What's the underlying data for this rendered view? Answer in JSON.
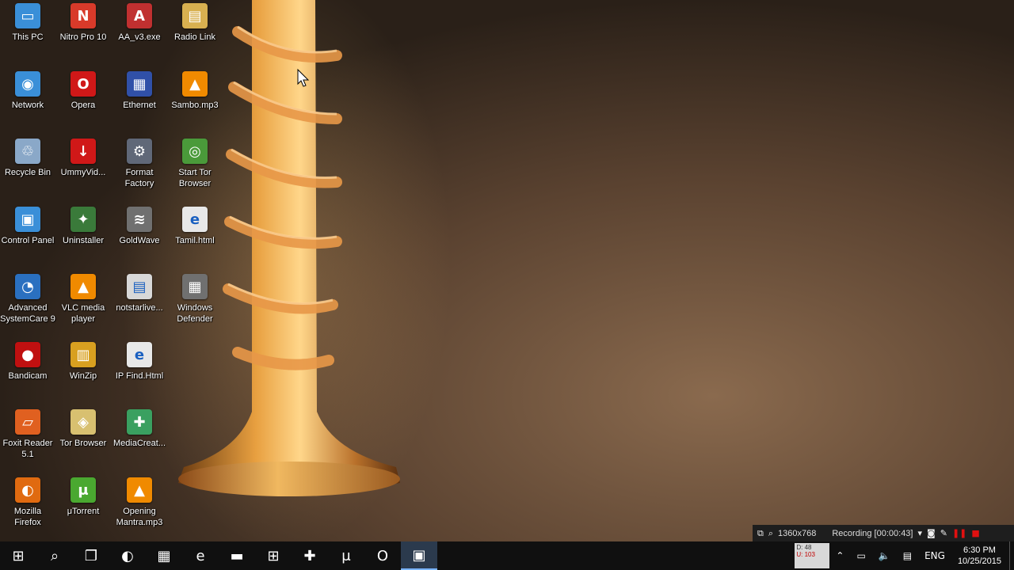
{
  "desktop": {
    "icons": [
      {
        "label": "This PC",
        "icon": "computer-icon",
        "color": "#3a8fd8",
        "glyph": "▭"
      },
      {
        "label": "Nitro Pro 10",
        "icon": "nitro-pdf-icon",
        "color": "#d83a2a",
        "glyph": "N"
      },
      {
        "label": "AA_v3.exe",
        "icon": "exe-icon",
        "color": "#c03030",
        "glyph": "A"
      },
      {
        "label": "Radio Link",
        "icon": "document-icon",
        "color": "#d8b050",
        "glyph": "▤"
      },
      {
        "label": "Network",
        "icon": "network-icon",
        "color": "#3a8fd8",
        "glyph": "◉"
      },
      {
        "label": "Opera",
        "icon": "opera-icon",
        "color": "#d01818",
        "glyph": "O"
      },
      {
        "label": "Ethernet",
        "icon": "ethernet-icon",
        "color": "#3050a8",
        "glyph": "▦"
      },
      {
        "label": "Sambo.mp3",
        "icon": "vlc-icon",
        "color": "#f08a00",
        "glyph": "▲"
      },
      {
        "label": "Recycle Bin",
        "icon": "recycle-bin-icon",
        "color": "#8aa8c8",
        "glyph": "♲"
      },
      {
        "label": "UmmyVid...",
        "icon": "ummy-icon",
        "color": "#d01818",
        "glyph": "↓"
      },
      {
        "label": "Format Factory",
        "icon": "format-factory-icon",
        "color": "#606878",
        "glyph": "⚙"
      },
      {
        "label": "Start Tor Browser",
        "icon": "tor-globe-icon",
        "color": "#4a9a3a",
        "glyph": "◎"
      },
      {
        "label": "Control Panel",
        "icon": "control-panel-icon",
        "color": "#3a8fd8",
        "glyph": "▣"
      },
      {
        "label": "Uninstaller",
        "icon": "uninstaller-icon",
        "color": "#3a7a3a",
        "glyph": "✦"
      },
      {
        "label": "GoldWave",
        "icon": "goldwave-icon",
        "color": "#707070",
        "glyph": "≋"
      },
      {
        "label": "Tamil.html",
        "icon": "html-file-icon",
        "color": "#e8e8e8",
        "glyph": "e"
      },
      {
        "label": "Advanced SystemCare 9",
        "icon": "systemcare-icon",
        "color": "#2a70c0",
        "glyph": "◔"
      },
      {
        "label": "VLC media player",
        "icon": "vlc-icon",
        "color": "#f08a00",
        "glyph": "▲"
      },
      {
        "label": "notstarlive...",
        "icon": "file-icon",
        "color": "#d8d8d8",
        "glyph": "▤"
      },
      {
        "label": "Windows Defender",
        "icon": "defender-icon",
        "color": "#707070",
        "glyph": "▦"
      },
      {
        "label": "Bandicam",
        "icon": "bandicam-icon",
        "color": "#c01010",
        "glyph": "●"
      },
      {
        "label": "WinZip",
        "icon": "winzip-icon",
        "color": "#d8a020",
        "glyph": "▥"
      },
      {
        "label": "IP Find.Html",
        "icon": "html-file-icon",
        "color": "#e8e8e8",
        "glyph": "e"
      },
      {
        "label": "",
        "icon": "",
        "color": "",
        "glyph": ""
      },
      {
        "label": "Foxit Reader 5.1",
        "icon": "foxit-icon",
        "color": "#e06020",
        "glyph": "▱"
      },
      {
        "label": "Tor Browser",
        "icon": "tor-folder-icon",
        "color": "#d8c070",
        "glyph": "◈"
      },
      {
        "label": "MediaCreat...",
        "icon": "media-creation-icon",
        "color": "#3aa060",
        "glyph": "✚"
      },
      {
        "label": "",
        "icon": "",
        "color": "",
        "glyph": ""
      },
      {
        "label": "Mozilla Firefox",
        "icon": "firefox-icon",
        "color": "#e06a10",
        "glyph": "◐"
      },
      {
        "label": "μTorrent",
        "icon": "utorrent-icon",
        "color": "#4aa830",
        "glyph": "μ"
      },
      {
        "label": "Opening Mantra.mp3",
        "icon": "vlc-icon",
        "color": "#f08a00",
        "glyph": "▲"
      }
    ]
  },
  "recording_bar": {
    "resolution": "1360x768",
    "status": "Recording [00:00:43]"
  },
  "taskbar": {
    "items": [
      {
        "name": "start-button",
        "glyph": "⊞"
      },
      {
        "name": "search-button",
        "glyph": "⌕"
      },
      {
        "name": "task-view-button",
        "glyph": "❐"
      },
      {
        "name": "taskbar-firefox",
        "glyph": "◐"
      },
      {
        "name": "taskbar-network-app",
        "glyph": "▦"
      },
      {
        "name": "taskbar-edge",
        "glyph": "e"
      },
      {
        "name": "taskbar-file-explorer",
        "glyph": "▬"
      },
      {
        "name": "taskbar-store",
        "glyph": "⊞"
      },
      {
        "name": "taskbar-media-creation",
        "glyph": "✚"
      },
      {
        "name": "taskbar-utorrent",
        "glyph": "μ"
      },
      {
        "name": "taskbar-opera",
        "glyph": "O"
      },
      {
        "name": "taskbar-bandicam",
        "glyph": "▣"
      }
    ],
    "netmeter": {
      "down": "D: 48",
      "up": "U: 103"
    },
    "language": "ENG",
    "time": "6:30 PM",
    "date": "10/25/2015"
  }
}
